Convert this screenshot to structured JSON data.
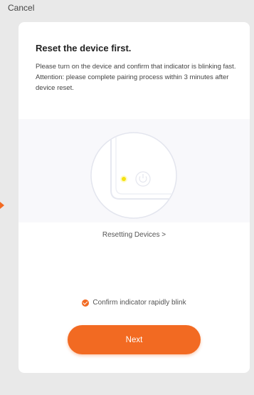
{
  "header": {
    "cancel_label": "Cancel"
  },
  "card": {
    "title": "Reset the device first.",
    "instruction": "Please turn on the device and confirm that indicator is blinking fast.",
    "attention": "Attention: please complete pairing process within 3 minutes after device reset."
  },
  "illustration": {
    "indicator_icon": "indicator-light-icon",
    "power_icon": "power-icon"
  },
  "links": {
    "resetting_devices": "Resetting Devices >"
  },
  "confirm": {
    "label": "Confirm indicator rapidly blink",
    "checked": true
  },
  "footer": {
    "next_label": "Next"
  },
  "colors": {
    "accent": "#f26a22",
    "background": "#e9e9e9",
    "card": "#ffffff"
  }
}
